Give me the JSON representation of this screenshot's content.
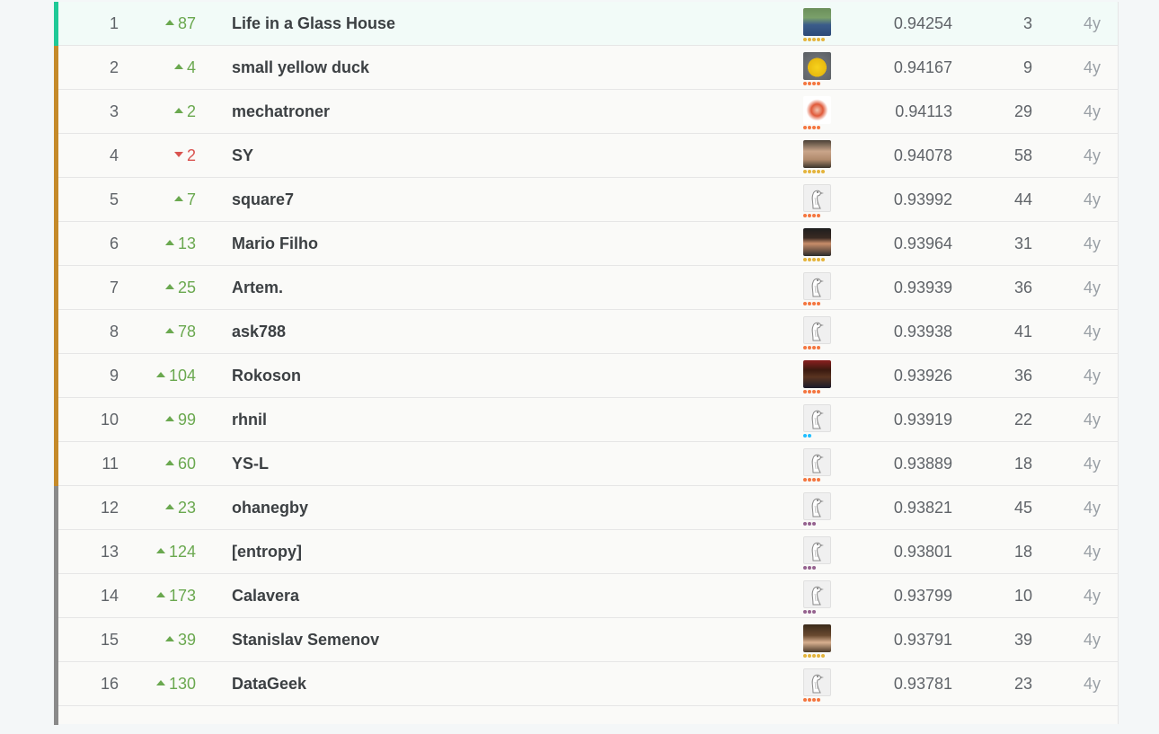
{
  "leaderboard": {
    "rows": [
      {
        "rank": "1",
        "delta": "87",
        "dir": "up",
        "team": "Life in a Glass House",
        "avatar": "photo-blue",
        "tier": "gold",
        "score": "0.94254",
        "entries": "3",
        "last": "4y",
        "medal": "winner"
      },
      {
        "rank": "2",
        "delta": "4",
        "dir": "up",
        "team": "small yellow duck",
        "avatar": "duck",
        "tier": "orange",
        "score": "0.94167",
        "entries": "9",
        "last": "4y",
        "medal": "silver"
      },
      {
        "rank": "3",
        "delta": "2",
        "dir": "up",
        "team": "mechatroner",
        "avatar": "rabbit",
        "tier": "orange",
        "score": "0.94113",
        "entries": "29",
        "last": "4y",
        "medal": "silver"
      },
      {
        "rank": "4",
        "delta": "2",
        "dir": "down",
        "team": "SY",
        "avatar": "photo-grey",
        "tier": "gold",
        "score": "0.94078",
        "entries": "58",
        "last": "4y",
        "medal": "silver"
      },
      {
        "rank": "5",
        "delta": "7",
        "dir": "up",
        "team": "square7",
        "avatar": "default",
        "tier": "orange",
        "score": "0.93992",
        "entries": "44",
        "last": "4y",
        "medal": "silver"
      },
      {
        "rank": "6",
        "delta": "13",
        "dir": "up",
        "team": "Mario Filho",
        "avatar": "photo-dark",
        "tier": "gold",
        "score": "0.93964",
        "entries": "31",
        "last": "4y",
        "medal": "silver"
      },
      {
        "rank": "7",
        "delta": "25",
        "dir": "up",
        "team": "Artem.",
        "avatar": "default",
        "tier": "orange",
        "score": "0.93939",
        "entries": "36",
        "last": "4y",
        "medal": "silver"
      },
      {
        "rank": "8",
        "delta": "78",
        "dir": "up",
        "team": "ask788",
        "avatar": "default",
        "tier": "orange",
        "score": "0.93938",
        "entries": "41",
        "last": "4y",
        "medal": "silver"
      },
      {
        "rank": "9",
        "delta": "104",
        "dir": "up",
        "team": "Rokoson",
        "avatar": "photo-red",
        "tier": "orange",
        "score": "0.93926",
        "entries": "36",
        "last": "4y",
        "medal": "silver"
      },
      {
        "rank": "10",
        "delta": "99",
        "dir": "up",
        "team": "rhnil",
        "avatar": "default",
        "tier": "blue",
        "score": "0.93919",
        "entries": "22",
        "last": "4y",
        "medal": "silver"
      },
      {
        "rank": "11",
        "delta": "60",
        "dir": "up",
        "team": "YS-L",
        "avatar": "default",
        "tier": "orange",
        "score": "0.93889",
        "entries": "18",
        "last": "4y",
        "medal": "silver"
      },
      {
        "rank": "12",
        "delta": "23",
        "dir": "up",
        "team": "ohanegby",
        "avatar": "default",
        "tier": "purple",
        "score": "0.93821",
        "entries": "45",
        "last": "4y",
        "medal": "bronze"
      },
      {
        "rank": "13",
        "delta": "124",
        "dir": "up",
        "team": "[entropy]",
        "avatar": "default",
        "tier": "purple",
        "score": "0.93801",
        "entries": "18",
        "last": "4y",
        "medal": "bronze"
      },
      {
        "rank": "14",
        "delta": "173",
        "dir": "up",
        "team": "Calavera",
        "avatar": "default",
        "tier": "purple",
        "score": "0.93799",
        "entries": "10",
        "last": "4y",
        "medal": "bronze"
      },
      {
        "rank": "15",
        "delta": "39",
        "dir": "up",
        "team": "Stanislav Semenov",
        "avatar": "photo-brown",
        "tier": "gold",
        "score": "0.93791",
        "entries": "39",
        "last": "4y",
        "medal": "bronze"
      },
      {
        "rank": "16",
        "delta": "130",
        "dir": "up",
        "team": "DataGeek",
        "avatar": "default",
        "tier": "orange",
        "score": "0.93781",
        "entries": "23",
        "last": "4y",
        "medal": "bronze"
      }
    ]
  },
  "tier_colors": {
    "gold": "#e4b43c",
    "orange": "#f4763f",
    "blue": "#20beff",
    "purple": "#95628f"
  },
  "tier_dots": {
    "gold": 5,
    "orange": 4,
    "blue": 2,
    "purple": 3
  }
}
